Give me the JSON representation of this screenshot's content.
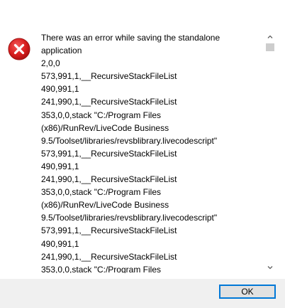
{
  "dialog": {
    "icon": "error-icon",
    "message_lines": [
      "There was an error while saving the standalone",
      "application",
      "2,0,0",
      "573,991,1,__RecursiveStackFileList",
      "490,991,1",
      "241,990,1,__RecursiveStackFileList",
      "353,0,0,stack \"C:/Program Files",
      "(x86)/RunRev/LiveCode Business",
      "9.5/Toolset/libraries/revsblibrary.livecodescript\"",
      "573,991,1,__RecursiveStackFileList",
      "490,991,1",
      "241,990,1,__RecursiveStackFileList",
      "353,0,0,stack \"C:/Program Files",
      "(x86)/RunRev/LiveCode Business",
      "9.5/Toolset/libraries/revsblibrary.livecodescript\"",
      "573,991,1,__RecursiveStackFileList",
      "490,991,1",
      "241,990,1,__RecursiveStackFileList",
      "353,0,0,stack \"C:/Program Files"
    ],
    "ok_label": "OK"
  },
  "colors": {
    "error_red": "#d81e1e",
    "button_border": "#0078d7",
    "footer_bg": "#f0f0f0",
    "scroll_thumb": "#cdcdcd"
  }
}
